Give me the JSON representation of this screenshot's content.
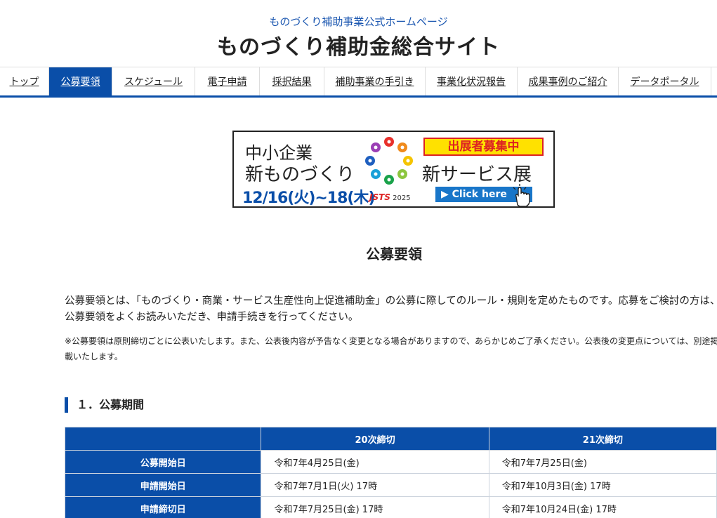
{
  "header": {
    "subtitle": "ものづくり補助事業公式ホームページ",
    "title": "ものづくり補助金総合サイト"
  },
  "nav": {
    "items": [
      {
        "label": "トップ"
      },
      {
        "label": "公募要領",
        "active": true
      },
      {
        "label": "スケジュール"
      },
      {
        "label": "電子申請"
      },
      {
        "label": "採択結果"
      },
      {
        "label": "補助事業の手引き"
      },
      {
        "label": "事業化状況報告"
      },
      {
        "label": "成果事例のご紹介"
      },
      {
        "label": "データポータル"
      }
    ]
  },
  "banner": {
    "line1": "中小企業",
    "line2": "新ものづくり",
    "date": "12/16(火)~18(木)",
    "logo_text": "2025",
    "logo_mark": "JSTS",
    "badge": "出展者募集中",
    "expo": "新サービス展",
    "click": "▶ Click here"
  },
  "main": {
    "heading": "公募要領",
    "intro": "公募要領とは、「ものづくり・商業・サービス生産性向上促進補助金」の公募に際してのルール・規則を定めたものです。応募をご検討の方は、公募要領をよくお読みいただき、申請手続きを行ってください。",
    "note": "※公募要領は原則締切ごとに公表いたします。また、公表後内容が予告なく変更となる場合がありますので、あらかじめご了承ください。公表後の変更点については、別途掲載いたします。",
    "section1_title": "１．公募期間"
  },
  "schedule_table": {
    "columns": [
      "",
      "20次締切",
      "21次締切"
    ],
    "rows": [
      {
        "label": "公募開始日",
        "values": [
          "令和7年4月25日(金)",
          "令和7年7月25日(金)"
        ]
      },
      {
        "label": "申請開始日",
        "values": [
          "令和7年7月1日(火) 17時",
          "令和7年10月3日(金) 17時"
        ]
      },
      {
        "label": "申請締切日",
        "values": [
          "令和7年7月25日(金) 17時",
          "令和7年10月24日(金) 17時"
        ]
      }
    ]
  },
  "colors": {
    "brand_blue": "#0a4ea8",
    "badge_yellow": "#ffe100",
    "badge_red": "#dd2222"
  }
}
